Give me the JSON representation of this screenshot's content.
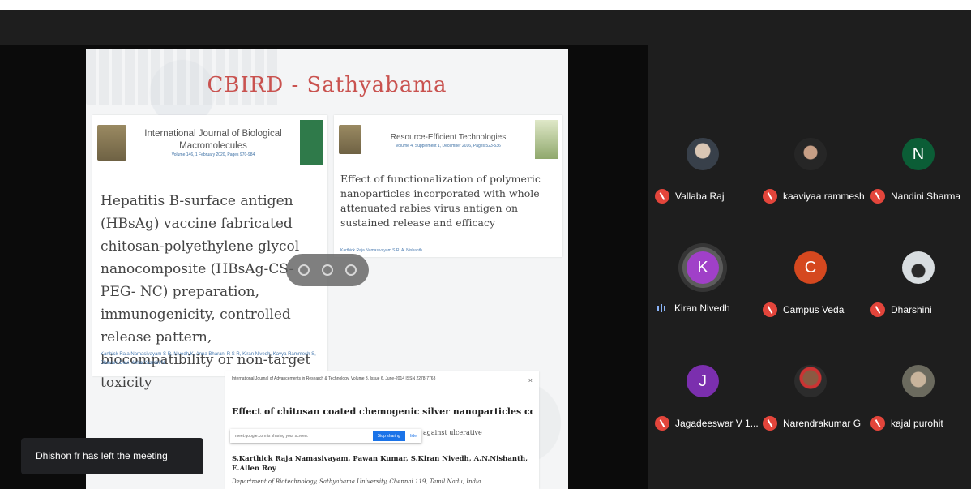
{
  "slide": {
    "title": "CBIRD - Sathyabama",
    "card1": {
      "journal": "International Journal of Biological Macromolecules",
      "volume": "Volume 146, 1 February 2020, Pages 970-984",
      "paper_title": "Hepatitis B-surface antigen (HBsAg) vaccine fabricated chitosan-polyethylene glycol nanocomposite (HBsAg-CS-PEG- NC) preparation, immunogenicity, controlled release pattern, biocompatibility or non-target toxicity",
      "authors": "Karthick Raja Namasivayam S R, Nivedh K, Anna Bharani R S R, Kiran Nivedh, Kavya Rammesh S, Bhavani Devi, Asha Yasmin N"
    },
    "card2": {
      "journal": "Resource-Efficient Technologies",
      "volume": "Volume 4, Supplement 1, December 2016, Pages 523-536",
      "paper_title": "Effect of functionalization of polymeric nanoparticles incorporated with whole attenuated rabies virus antigen on sustained release and efficacy",
      "authors": "Karthick Raja Namasivayam S R, A. Nishanth"
    },
    "card3": {
      "header": "International Journal of Advancements in Research & Technology, Volume 3, Issue 6, June-2014 ISSN 2278-7763",
      "paper_title": "Effect of chitosan coated chemogenic silver nanoparticles coated syringes against",
      "title_tail": "against ulcerative",
      "authors": "S.Karthick Raja Namasivayam, Pawan Kumar, S.Kiran Nivedh, A.N.Nishanth, E.Allen Roy",
      "affiliation": "Department of Biotechnology, Sathyabama University, Chennai 119, Tamil Nadu, India",
      "close": "×"
    },
    "share_bar": {
      "text": "meet.google.com is sharing your screen.",
      "stop_label": "Stop sharing",
      "hide_label": "Hide"
    }
  },
  "participants": [
    {
      "name": "Vallaba Raj",
      "initial": "",
      "avatar_type": "photo",
      "color": "#38404a",
      "muted": true
    },
    {
      "name": "kaaviyaa rammesh",
      "initial": "",
      "avatar_type": "photo",
      "color": "#2b2b2b",
      "muted": true
    },
    {
      "name": "Nandini Sharma",
      "initial": "N",
      "avatar_type": "letter",
      "color": "#0b5d36",
      "muted": true
    },
    {
      "name": "Kiran Nivedh",
      "initial": "K",
      "avatar_type": "letter",
      "color": "#a040c8",
      "muted": false
    },
    {
      "name": "Campus Veda",
      "initial": "C",
      "avatar_type": "letter",
      "color": "#d5481f",
      "muted": true
    },
    {
      "name": "Dharshini",
      "initial": "",
      "avatar_type": "photo",
      "color": "#4a5058",
      "muted": true
    },
    {
      "name": "Jagadeeswar V 1...",
      "initial": "J",
      "avatar_type": "letter",
      "color": "#7b2fae",
      "muted": true
    },
    {
      "name": "Narendrakumar G",
      "initial": "",
      "avatar_type": "photo",
      "color": "#2c2c2c",
      "muted": true
    },
    {
      "name": "kajal purohit",
      "initial": "",
      "avatar_type": "photo",
      "color": "#6b6a5e",
      "muted": true
    }
  ],
  "toast": {
    "text": "Dhishon fr has left the meeting"
  },
  "colors": {
    "mic_off": "#e3453b",
    "accent": "#1a73e8",
    "title": "#c9524f"
  }
}
